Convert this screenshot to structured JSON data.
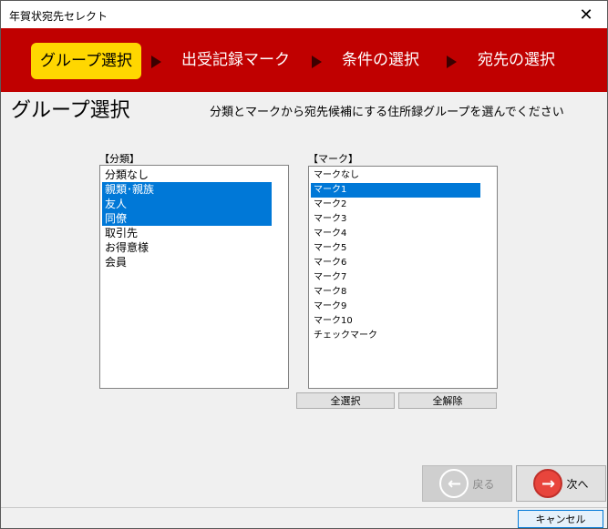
{
  "window": {
    "title": "年賀状宛先セレクト",
    "close_glyph": "✕"
  },
  "steps": [
    {
      "label": "グループ選択",
      "active": true
    },
    {
      "label": "出受記録マーク",
      "active": false
    },
    {
      "label": "条件の選択",
      "active": false
    },
    {
      "label": "宛先の選択",
      "active": false
    }
  ],
  "page": {
    "heading": "グループ選択",
    "description": "分類とマークから宛先候補にする住所録グループを選んでください"
  },
  "category_list": {
    "caption": "【分類】",
    "items": [
      {
        "label": "分類なし",
        "selected": false
      },
      {
        "label": "親類･親族",
        "selected": true
      },
      {
        "label": "友人",
        "selected": true
      },
      {
        "label": "同僚",
        "selected": true
      },
      {
        "label": "取引先",
        "selected": false
      },
      {
        "label": "お得意様",
        "selected": false
      },
      {
        "label": "会員",
        "selected": false
      }
    ]
  },
  "mark_list": {
    "caption": "【マーク】",
    "items": [
      {
        "label": "マークなし",
        "selected": false
      },
      {
        "label": "マーク1",
        "selected": true
      },
      {
        "label": "マーク2",
        "selected": false
      },
      {
        "label": "マーク3",
        "selected": false
      },
      {
        "label": "マーク4",
        "selected": false
      },
      {
        "label": "マーク5",
        "selected": false
      },
      {
        "label": "マーク6",
        "selected": false
      },
      {
        "label": "マーク7",
        "selected": false
      },
      {
        "label": "マーク8",
        "selected": false
      },
      {
        "label": "マーク9",
        "selected": false
      },
      {
        "label": "マーク10",
        "selected": false
      },
      {
        "label": "チェックマーク",
        "selected": false
      }
    ]
  },
  "buttons": {
    "select_all": "全選択",
    "deselect_all": "全解除",
    "back": "戻る",
    "next": "次へ",
    "cancel": "キャンセル"
  },
  "colors": {
    "banner": "#c00000",
    "active_step": "#ffd700",
    "selection": "#0078d7"
  }
}
